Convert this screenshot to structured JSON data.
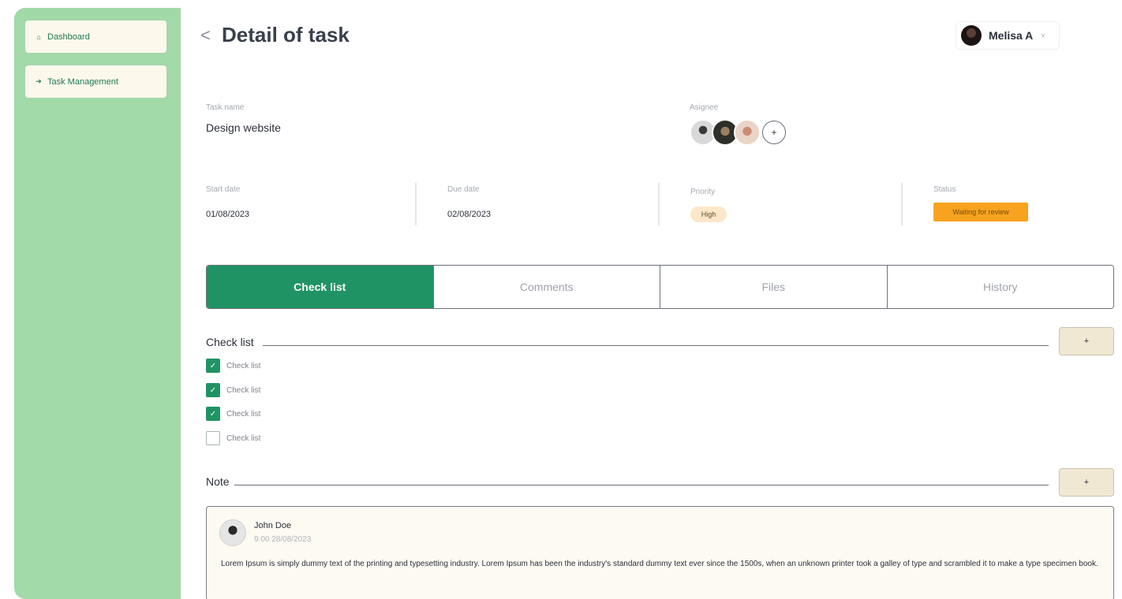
{
  "sidebar": {
    "items": [
      {
        "icon": "home-icon",
        "glyph": "⌂",
        "label": "Dashboard"
      },
      {
        "icon": "arrow-icon",
        "glyph": "➔",
        "label": "Task Management"
      }
    ]
  },
  "header": {
    "back_glyph": "<",
    "title": "Detail of task",
    "user_name": "Melisa A",
    "user_caret": "˅"
  },
  "task": {
    "name_label": "Task name",
    "name": "Design website",
    "assignee_label": "Asignee",
    "add_assignee": "+",
    "start_label": "Start date",
    "start_date": "01/08/2023",
    "due_label": "Due date",
    "due_date": "02/08/2023",
    "priority_label": "Priority",
    "priority": "High",
    "status_label": "Status",
    "status": "Waiting for review"
  },
  "tabs": [
    {
      "label": "Check list"
    },
    {
      "label": "Comments"
    },
    {
      "label": "Files"
    },
    {
      "label": "History"
    }
  ],
  "checklist": {
    "title": "Check list",
    "add_label": "+",
    "items": [
      {
        "label": "Check list",
        "checked": true
      },
      {
        "label": "Check list",
        "checked": true
      },
      {
        "label": "Check list",
        "checked": true
      },
      {
        "label": "Check list",
        "checked": false
      }
    ],
    "check_glyph": "✓"
  },
  "note": {
    "title": "Note",
    "add_label": "+",
    "author": "John Doe",
    "time": "9:00 28/08/2023",
    "text": "Lorem Ipsum is simply dummy text of the printing and typesetting industry. Lorem Ipsum has been the industry's standard dummy text ever since the 1500s, when an unknown printer took a galley of type and scrambled it to make a type specimen book."
  },
  "colors": {
    "sidebar": "#a2d9a9",
    "accent": "#209365",
    "status": "#f7a320",
    "priority": "#fde7c9"
  }
}
